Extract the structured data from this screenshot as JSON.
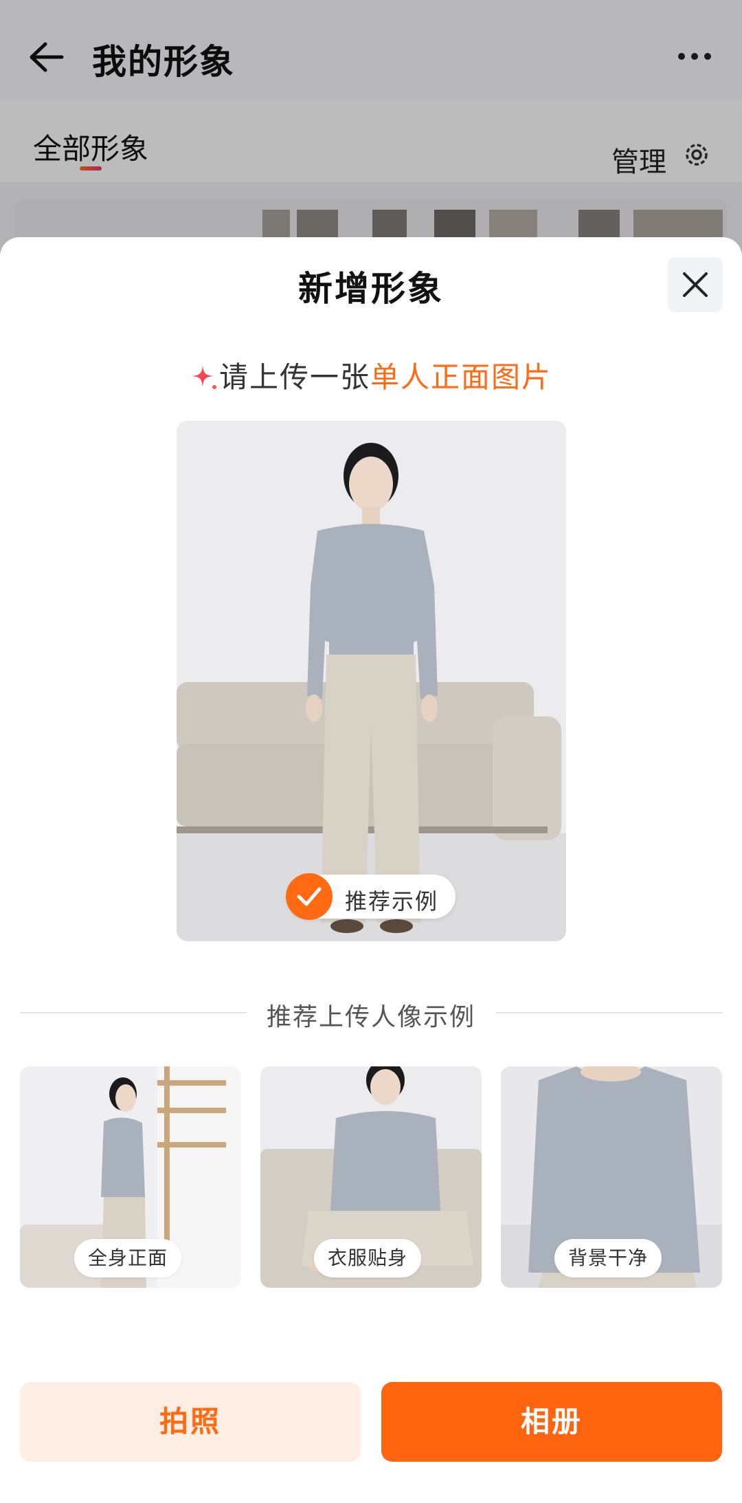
{
  "topbar": {
    "title": "我的形象"
  },
  "tabs": {
    "all_label": "全部形象",
    "manage_label": "管理"
  },
  "sheet": {
    "title": "新增形象",
    "hint_prefix": "请上传一张",
    "hint_highlight": "单人正面图片",
    "recommended_badge": "推荐示例",
    "examples_heading": "推荐上传人像示例",
    "examples": [
      {
        "label": "全身正面"
      },
      {
        "label": "衣服贴身"
      },
      {
        "label": "背景干净"
      }
    ],
    "buttons": {
      "camera": "拍照",
      "album": "相册"
    }
  },
  "colors": {
    "accent": "#ff6a13",
    "accent_light": "#ffeee3"
  },
  "icons": [
    "back-arrow-icon",
    "more-icon",
    "gear-icon",
    "close-icon",
    "sparkle-icon",
    "checkmark-icon"
  ]
}
